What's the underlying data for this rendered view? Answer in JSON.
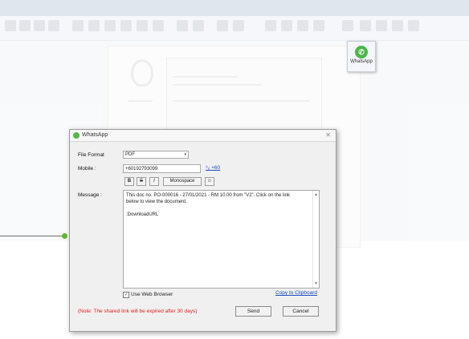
{
  "tile": {
    "label": "WhatsApp",
    "icon": "whatsapp-icon"
  },
  "dialog": {
    "title": "WhatsApp",
    "labels": {
      "file_format": "File Format",
      "mobile": "Mobile :",
      "message": "Message :"
    },
    "file_format_value": "PDF",
    "mobile_value": "+60192793099",
    "country_code_link": "+60",
    "format_buttons": {
      "bold": "B",
      "strike": "S",
      "italic": "I",
      "monospace": "Monospace"
    },
    "message_lines": [
      "This doc no. PO-000016 - 27/01/2021 - RM 10.00 from \"V2\". Click on the link",
      "below to view the document.",
      "",
      ":DownloadURL"
    ],
    "use_web_browser_label": "Use Web Browser",
    "use_web_browser_checked": true,
    "copy_link": "Copy to Clipboard",
    "note": "(Note: The shared link will be expired after 30 days)",
    "send_label": "Send",
    "cancel_label": "Cancel"
  },
  "colors": {
    "whatsapp_green": "#4cb648",
    "link_blue": "#1a4cc0",
    "note_red": "#e02020"
  }
}
